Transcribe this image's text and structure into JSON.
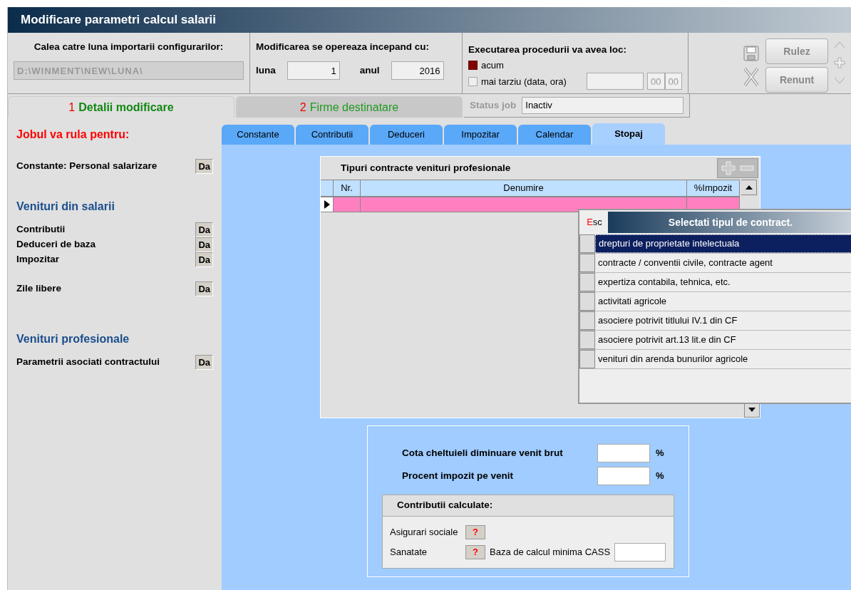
{
  "window": {
    "title": "Modificare parametri calcul salarii"
  },
  "path_section": {
    "label": "Calea catre luna importarii configurarilor:",
    "value": "D:\\WINMENT\\NEW\\LUNA\\",
    "disabled": true
  },
  "start_section": {
    "label": "Modificarea se opereaza incepand cu:",
    "month_label": "luna",
    "month_value": "1",
    "year_label": "anul",
    "year_value": "2016"
  },
  "execution_section": {
    "label": "Executarea procedurii va avea loc:",
    "options": [
      {
        "label": "acum",
        "selected": true
      },
      {
        "label": "mai tarziu (data, ora)",
        "selected": false
      }
    ],
    "hour_value": "00",
    "minute_value": "00"
  },
  "buttons": [
    {
      "label": "Rulez",
      "disabled": true
    },
    {
      "label": "Renunt",
      "disabled": true
    }
  ],
  "main_tabs": [
    {
      "number": "1",
      "label": "Detalii modificare",
      "selected": true
    },
    {
      "number": "2",
      "label": "Firme destinatare",
      "selected": false
    }
  ],
  "status_job": {
    "label": "Status job",
    "value": "Inactiv"
  },
  "left_panel": {
    "heading": "Jobul va rula pentru:",
    "sections": [
      {
        "groups": [
          [
            {
              "label": "Constante: Personal salarizare",
              "value": "Da"
            }
          ]
        ]
      },
      {
        "title": "Venituri din salarii",
        "groups": [
          [
            {
              "label": "Contributii",
              "value": "Da"
            },
            {
              "label": "Deduceri de baza",
              "value": "Da"
            },
            {
              "label": "Impozitar",
              "value": "Da"
            }
          ],
          [
            {
              "label": "Zile libere",
              "value": "Da"
            }
          ]
        ]
      },
      {
        "title": "Venituri profesionale",
        "groups": [
          [
            {
              "label": "Parametrii asociati contractului",
              "value": "Da"
            }
          ]
        ]
      }
    ]
  },
  "sub_tabs": [
    {
      "label": "Constante",
      "selected": false
    },
    {
      "label": "Contributii",
      "selected": false
    },
    {
      "label": "Deduceri",
      "selected": false
    },
    {
      "label": "Impozitar",
      "selected": false
    },
    {
      "label": "Calendar",
      "selected": false
    },
    {
      "label": "Stopaj",
      "selected": true
    }
  ],
  "grid": {
    "title": "Tipuri contracte venituri profesionale",
    "columns": [
      "Nr.",
      "Denumire",
      "%Impozit"
    ],
    "rows": [
      {
        "current": true
      }
    ]
  },
  "popup": {
    "esc": "Esc",
    "title": "Selectati tipul de contract.",
    "items": [
      {
        "label": "drepturi de proprietate intelectuala",
        "selected": true
      },
      {
        "label": "contracte / conventii civile, contracte agent",
        "selected": false
      },
      {
        "label": "expertiza contabila, tehnica, etc.",
        "selected": false
      },
      {
        "label": "activitati agricole",
        "selected": false
      },
      {
        "label": "asociere potrivit titlului IV.1 din CF",
        "selected": false
      },
      {
        "label": "asociere potrivit art.13 lit.e din CF",
        "selected": false
      },
      {
        "label": "venituri din arenda bunurilor agricole",
        "selected": false
      }
    ]
  },
  "rates": [
    {
      "label": "Cota cheltuieli diminuare venit brut",
      "unit": "%"
    },
    {
      "label": "Procent impozit pe venit",
      "unit": "%"
    }
  ],
  "contributions": {
    "title": "Contributii calculate:",
    "rows": [
      {
        "label": "Asigurari sociale",
        "value": "?"
      },
      {
        "label": "Sanatate",
        "value": "?",
        "extra_label": "Baza de calcul minima CASS"
      }
    ]
  }
}
